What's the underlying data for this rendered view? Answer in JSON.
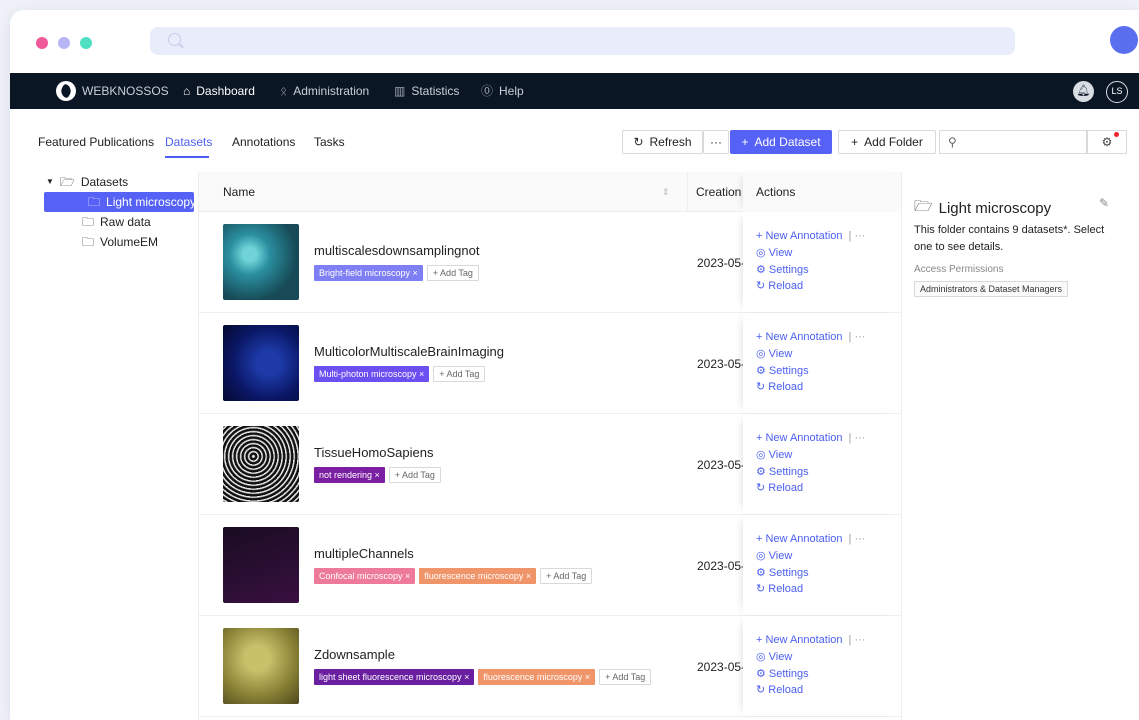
{
  "navbar": {
    "brand": "WEBKNOSSOS",
    "items": [
      {
        "label": "Dashboard",
        "icon": "home-icon"
      },
      {
        "label": "Administration",
        "icon": "team-icon"
      },
      {
        "label": "Statistics",
        "icon": "bar-chart-icon"
      },
      {
        "label": "Help",
        "icon": "question-icon"
      }
    ],
    "avatar": "LS"
  },
  "tabs": [
    "Featured Publications",
    "Datasets",
    "Annotations",
    "Tasks"
  ],
  "active_tab": "Datasets",
  "toolbar": {
    "refresh": "Refresh",
    "more": "···",
    "add_dataset": "Add Dataset",
    "add_folder": "Add Folder"
  },
  "tree": {
    "root": "Datasets",
    "children": [
      "Light microscopy",
      "Raw data",
      "VolumeEM"
    ],
    "selected": "Light microscopy"
  },
  "table": {
    "columns": {
      "name": "Name",
      "creation": "Creation Date",
      "actions": "Actions"
    },
    "rows": [
      {
        "name": "multiscalesdownsamplingnot",
        "date": "2023-05-",
        "tags": [
          {
            "label": "Bright-field microscopy ×",
            "color": "#7f7ff5"
          }
        ]
      },
      {
        "name": "MulticolorMultiscaleBrainImaging",
        "date": "2023-05-",
        "tags": [
          {
            "label": "Multi-photon microscopy ×",
            "color": "#6b4ff0"
          }
        ]
      },
      {
        "name": "TissueHomoSapiens",
        "date": "2023-05-",
        "tags": [
          {
            "label": "not rendering ×",
            "color": "#7a1fa2"
          }
        ]
      },
      {
        "name": "multipleChannels",
        "date": "2023-05-",
        "tags": [
          {
            "label": "Confocal microscopy ×",
            "color": "#ee7a9a"
          },
          {
            "label": "fluorescence microscopy ×",
            "color": "#f0956a"
          }
        ]
      },
      {
        "name": "Zdownsample",
        "date": "2023-05-",
        "tags": [
          {
            "label": "light sheet fluorescence microscopy ×",
            "color": "#6a1fa0"
          },
          {
            "label": "fluorescence microscopy ×",
            "color": "#f0956a"
          }
        ]
      }
    ],
    "add_tag": "+ Add Tag",
    "actions": {
      "new_annotation": "New Annotation",
      "view": "View",
      "settings": "Settings",
      "reload": "Reload"
    }
  },
  "panel": {
    "title": "Light microscopy",
    "description": "This folder contains 9 datasets*. Select one to see details.",
    "access_label": "Access Permissions",
    "access_value": "Administrators & Dataset Managers"
  }
}
